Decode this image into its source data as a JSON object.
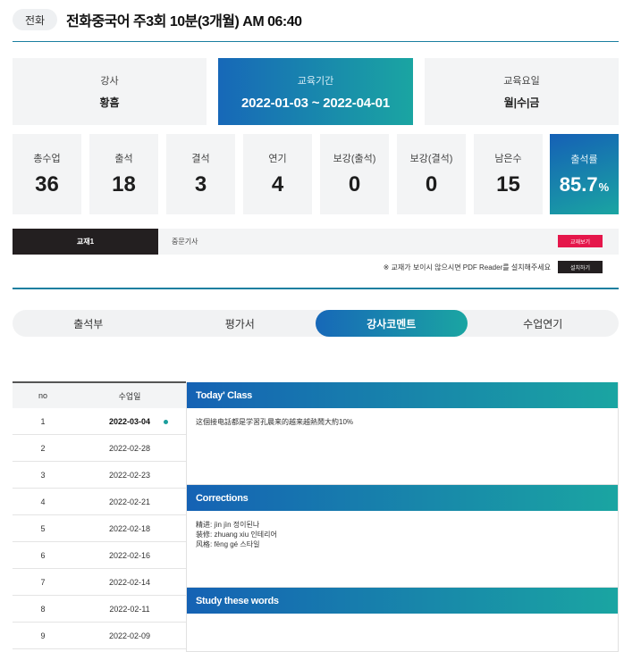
{
  "header": {
    "tag": "전화",
    "title": "전화중국어 주3회 10분(3개월) AM 06:40"
  },
  "info": [
    {
      "label": "강사",
      "value": "황흠"
    },
    {
      "label": "교육기간",
      "value": "2022-01-03 ~ 2022-04-01"
    },
    {
      "label": "교육요일",
      "value": "월|수|금"
    }
  ],
  "stats": [
    {
      "label": "총수업",
      "value": "36"
    },
    {
      "label": "출석",
      "value": "18"
    },
    {
      "label": "결석",
      "value": "3"
    },
    {
      "label": "연기",
      "value": "4"
    },
    {
      "label": "보강(출석)",
      "value": "0"
    },
    {
      "label": "보강(결석)",
      "value": "0"
    },
    {
      "label": "남은수",
      "value": "15"
    }
  ],
  "rate": {
    "label": "출석률",
    "value": "85.7",
    "unit": "%"
  },
  "textbook": {
    "tab": "교재1",
    "name": "중문기사",
    "button": "교재보기",
    "notice": "※ 교재가 보이시 않으시면 PDF Reader를 설치해주세요",
    "install": "설치하기"
  },
  "tabs": [
    {
      "label": "출석부",
      "active": false
    },
    {
      "label": "평가서",
      "active": false
    },
    {
      "label": "강사코멘트",
      "active": true
    },
    {
      "label": "수업연기",
      "active": false
    }
  ],
  "lessons": {
    "header": {
      "no": "no",
      "date": "수업일"
    },
    "rows": [
      {
        "no": "1",
        "date": "2022-03-04"
      },
      {
        "no": "2",
        "date": "2022-02-28"
      },
      {
        "no": "3",
        "date": "2022-02-23"
      },
      {
        "no": "4",
        "date": "2022-02-21"
      },
      {
        "no": "5",
        "date": "2022-02-18"
      },
      {
        "no": "6",
        "date": "2022-02-16"
      },
      {
        "no": "7",
        "date": "2022-02-14"
      },
      {
        "no": "8",
        "date": "2022-02-11"
      },
      {
        "no": "9",
        "date": "2022-02-09"
      }
    ]
  },
  "comments": {
    "today": {
      "title": "Today' Class",
      "text": "这個接电話都是学習孔晨来的越来越熱鬧大約10%"
    },
    "corrections": {
      "title": "Corrections",
      "lines": [
        "精进: jìn jìn 정이된나",
        "装修: zhuang xiu 인테리어",
        "风格: fēng gé 스타일"
      ]
    },
    "words": {
      "title": "Study these words"
    }
  },
  "colors": {
    "accent_start": "#1768b8",
    "accent_end": "#1aa5a2",
    "dark": "#231f20",
    "pink": "#e5174b"
  }
}
